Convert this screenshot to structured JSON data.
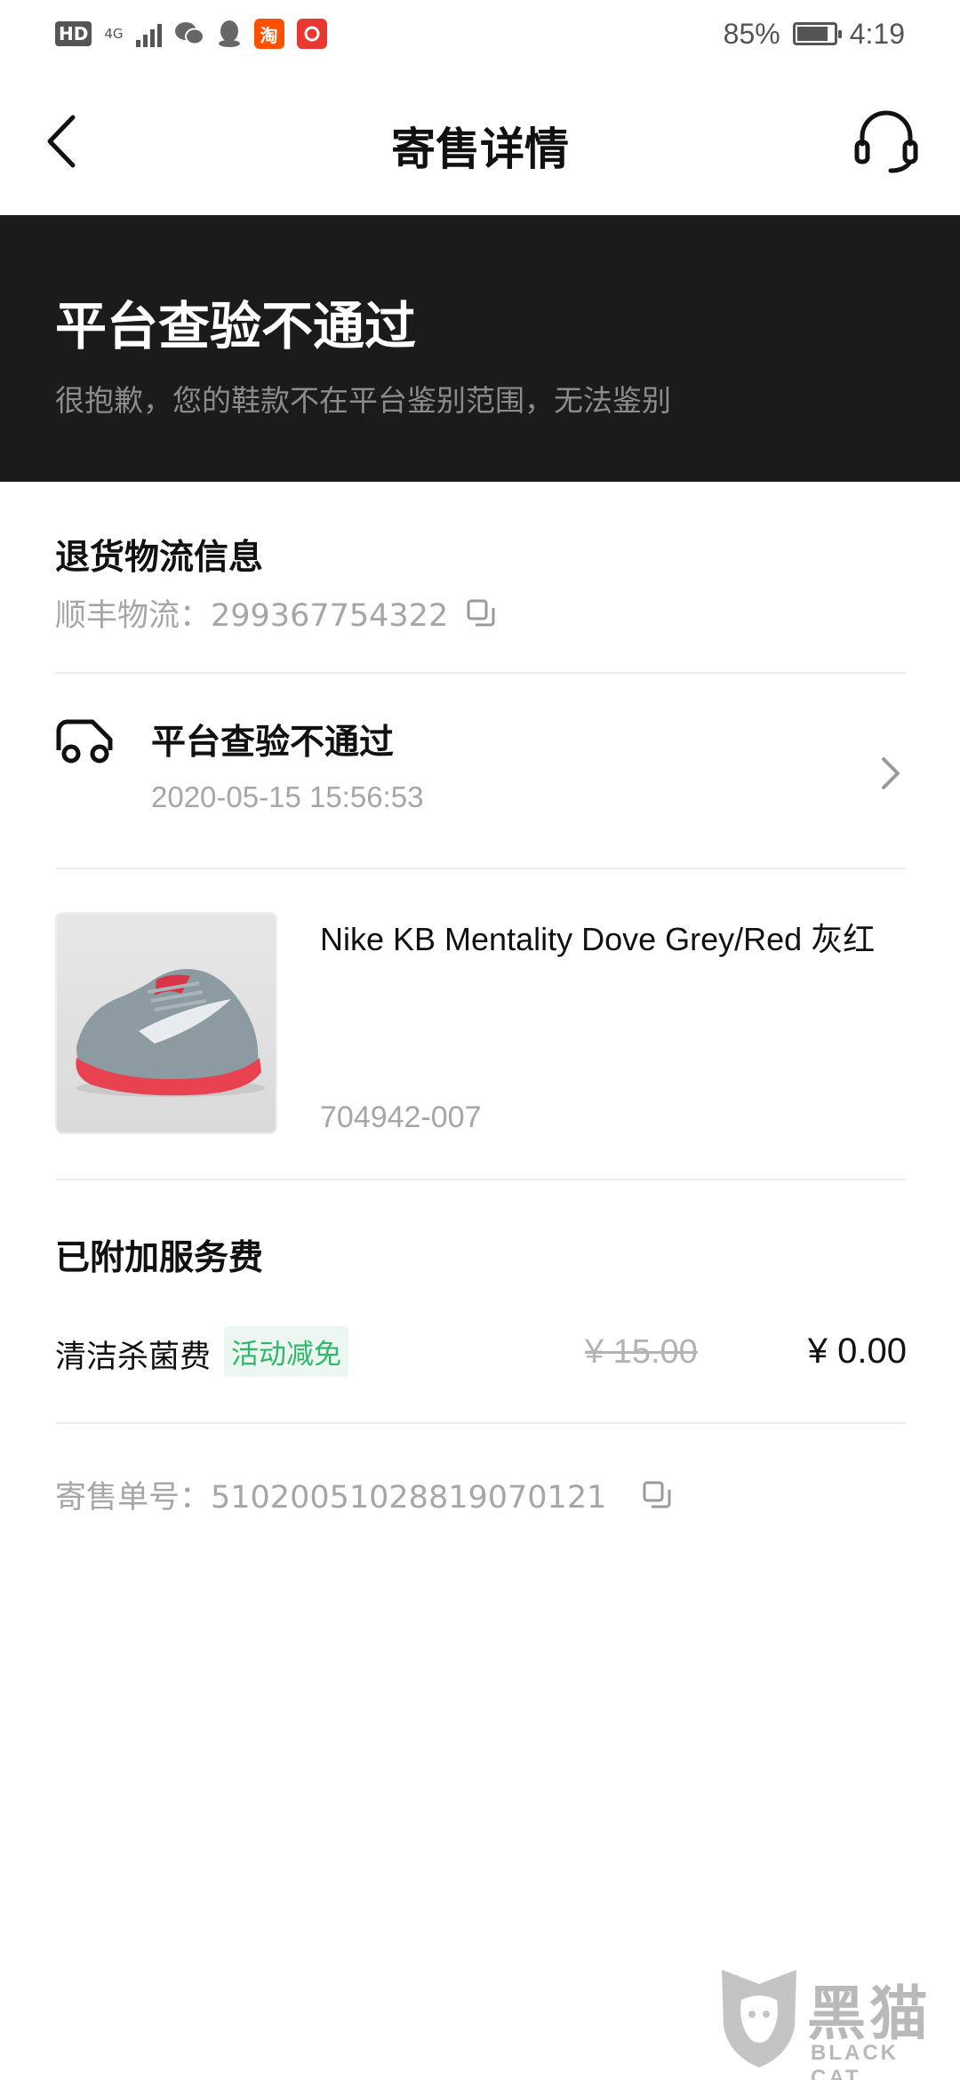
{
  "status_bar": {
    "hd": "HD",
    "network": "4G",
    "battery": "85%",
    "battery_level": 0.85,
    "time": "4:19",
    "apps": [
      {
        "name": "wechat-icon"
      },
      {
        "name": "qq-icon"
      },
      {
        "name": "taobao-icon",
        "glyph": "淘",
        "color": "#ff5000"
      },
      {
        "name": "app-icon",
        "glyph": "",
        "color": "#e8382f"
      }
    ]
  },
  "nav": {
    "title": "寄售详情"
  },
  "banner": {
    "title": "平台查验不通过",
    "description": "很抱歉，您的鞋款不在平台鉴别范围，无法鉴别"
  },
  "logistics": {
    "title": "退货物流信息",
    "carrier_line": "顺丰物流：299367754322"
  },
  "tracking": {
    "status": "平台查验不通过",
    "time": "2020-05-15 15:56:53"
  },
  "product": {
    "name": "Nike KB Mentality Dove Grey/Red 灰红",
    "code": "704942-007"
  },
  "services": {
    "title": "已附加服务费",
    "fee_label": "清洁杀菌费",
    "fee_tag": "活动减免",
    "original_price": "¥ 15.00",
    "final_price": "¥ 0.00"
  },
  "order": {
    "number_line": "寄售单号：510200510288190701​21"
  },
  "watermark": {
    "text": "黑猫",
    "sub": "BLACK CAT"
  },
  "colors": {
    "banner_bg": "#1b1b1b",
    "tag_green": "#2fb86a",
    "muted": "#a6a6a6"
  }
}
